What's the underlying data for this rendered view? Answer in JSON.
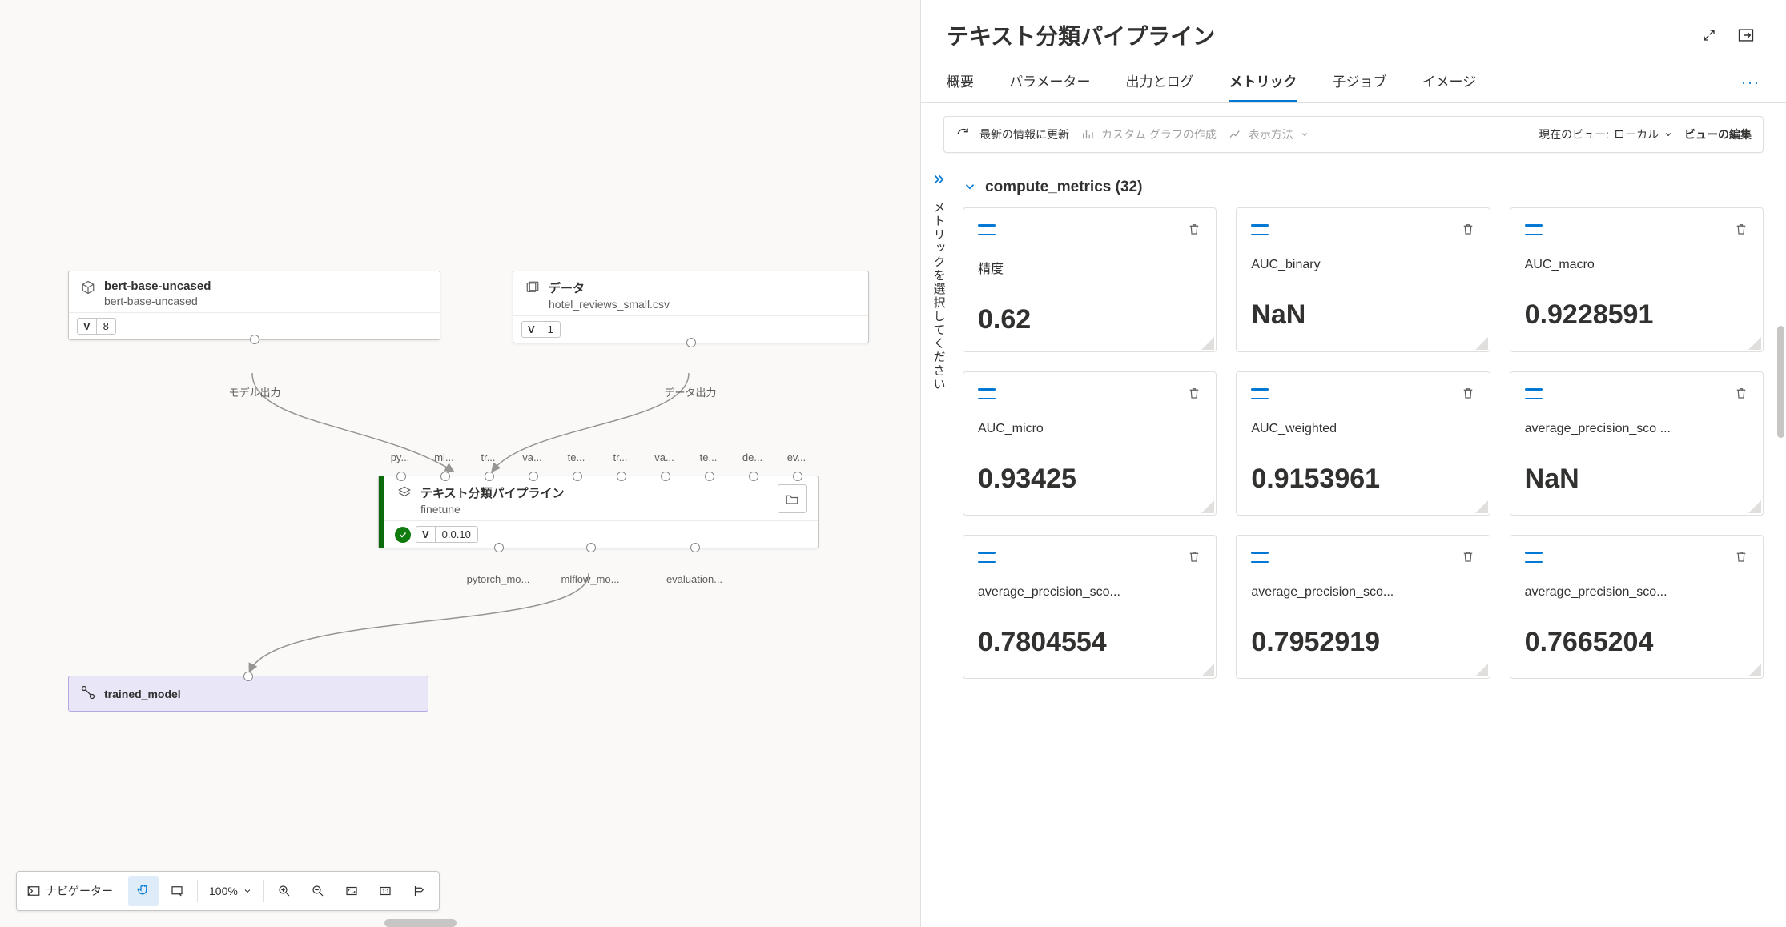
{
  "panel": {
    "title": "テキスト分類パイプライン",
    "tabs": [
      "概要",
      "パラメーター",
      "出力とログ",
      "メトリック",
      "子ジョブ",
      "イメージ"
    ],
    "active_tab": 3,
    "refresh": "最新の情報に更新",
    "toolbar_disabled1": "カスタム グラフの作成",
    "toolbar_disabled2": "表示方法",
    "current_view_label": "現在のビュー:",
    "current_view_value": "ローカル",
    "edit_view": "ビューの編集",
    "side_label": "メトリックを選択してください",
    "group_name": "compute_metrics",
    "group_count": "(32)",
    "metrics": [
      {
        "name": "精度",
        "value": "0.62"
      },
      {
        "name": "AUC_binary",
        "value": "NaN"
      },
      {
        "name": "AUC_macro",
        "value": "0.9228591"
      },
      {
        "name": "AUC_micro",
        "value": "0.93425"
      },
      {
        "name": "AUC_weighted",
        "value": "0.9153961"
      },
      {
        "name": "average_precision_sco ...",
        "value": "NaN"
      },
      {
        "name": "average_precision_sco...",
        "value": "0.7804554"
      },
      {
        "name": "average_precision_sco...",
        "value": "0.7952919"
      },
      {
        "name": "average_precision_sco...",
        "value": "0.7665204"
      }
    ]
  },
  "canvas": {
    "bert_node": {
      "title": "bert-base-uncased",
      "sub": "bert-base-uncased",
      "version": "8",
      "out_label": "モデル出力"
    },
    "data_node": {
      "title": "データ",
      "sub": "hotel_reviews_small.csv",
      "version": "1",
      "out_label": "データ出力"
    },
    "pipe_node": {
      "title": "テキスト分類パイプライン",
      "sub": "finetune",
      "version": "0.0.10",
      "in_labels": [
        "py...",
        "ml...",
        "tr...",
        "va...",
        "te...",
        "tr...",
        "va...",
        "te...",
        "de...",
        "ev..."
      ],
      "out_labels": [
        "pytorch_mo...",
        "mlflow_mo...",
        "evaluation..."
      ]
    },
    "trained_node": "trained_model"
  },
  "bottom_toolbar": {
    "navigator": "ナビゲーター",
    "zoom": "100%"
  }
}
